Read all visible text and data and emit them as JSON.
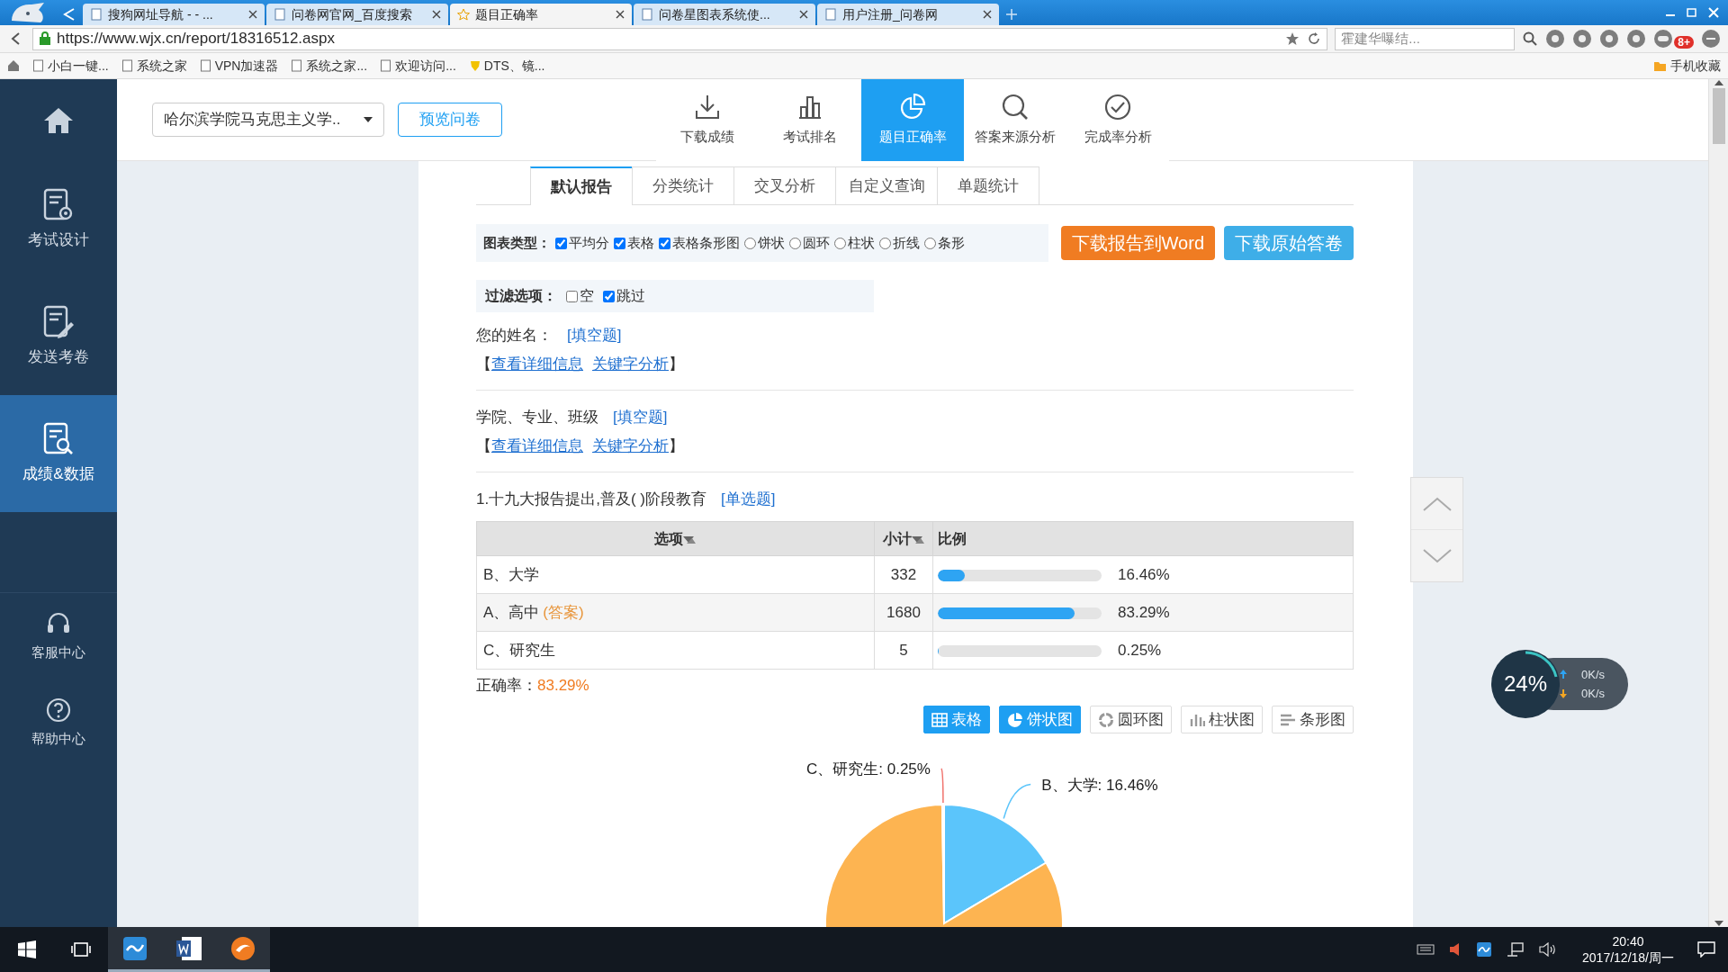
{
  "browser": {
    "tabs": [
      {
        "title": "搜狗网址导航 - - ...",
        "selected": false
      },
      {
        "title": "问卷网官网_百度搜索",
        "selected": false
      },
      {
        "title": "题目正确率",
        "selected": true
      },
      {
        "title": "问卷星图表系统使...",
        "selected": false
      },
      {
        "title": "用户注册_问卷网",
        "selected": false
      }
    ],
    "url": "https://www.wjx.cn/report/18316512.aspx",
    "search": {
      "value": "霍建华曝结..."
    },
    "badge": "8+",
    "bookmarks": [
      "小白一键...",
      "系统之家",
      "VPN加速器",
      "系统之家...",
      "欢迎访问...",
      "DTS、镜..."
    ],
    "mobile_favorites": "手机收藏"
  },
  "sidebar": {
    "items": [
      {
        "label": "考试设计",
        "selected": false
      },
      {
        "label": "发送考卷",
        "selected": false
      },
      {
        "label": "成绩&数据",
        "selected": true
      }
    ],
    "help": [
      "客服中心",
      "帮助中心"
    ]
  },
  "header": {
    "survey_select": "哈尔滨学院马克思主义学..",
    "preview": "预览问卷",
    "nav": [
      {
        "label": "下载成绩",
        "selected": false
      },
      {
        "label": "考试排名",
        "selected": false
      },
      {
        "label": "题目正确率",
        "selected": true
      },
      {
        "label": "答案来源分析",
        "selected": false
      },
      {
        "label": "完成率分析",
        "selected": false
      }
    ]
  },
  "report": {
    "tabs": [
      {
        "label": "默认报告",
        "selected": true
      },
      {
        "label": "分类统计",
        "selected": false
      },
      {
        "label": "交叉分析",
        "selected": false
      },
      {
        "label": "自定义查询",
        "selected": false
      },
      {
        "label": "单题统计",
        "selected": false
      }
    ],
    "chart_type": {
      "label": "图表类型：",
      "options": [
        {
          "label": "平均分",
          "kind": "checkbox",
          "checked": true
        },
        {
          "label": "表格",
          "kind": "checkbox",
          "checked": true
        },
        {
          "label": "表格条形图",
          "kind": "checkbox",
          "checked": true
        },
        {
          "label": "饼状",
          "kind": "radio",
          "checked": false
        },
        {
          "label": "圆环",
          "kind": "radio",
          "checked": false
        },
        {
          "label": "柱状",
          "kind": "radio",
          "checked": false
        },
        {
          "label": "折线",
          "kind": "radio",
          "checked": false
        },
        {
          "label": "条形",
          "kind": "radio",
          "checked": false
        }
      ]
    },
    "downloads": [
      {
        "label": "下载报告到Word",
        "color": "#f07c22"
      },
      {
        "label": "下载原始答卷",
        "color": "#3eaee8"
      }
    ],
    "filter": {
      "label": "过滤选项：",
      "options": [
        {
          "label": "空",
          "checked": false
        },
        {
          "label": "跳过",
          "checked": true
        }
      ]
    },
    "text_questions": [
      {
        "title": "您的姓名：",
        "type": "[填空题]",
        "open": "【",
        "links": [
          "查看详细信息",
          "关键字分析"
        ],
        "close": "】"
      },
      {
        "title": "学院、专业、班级",
        "type": "[填空题]",
        "open": "【",
        "links": [
          "查看详细信息",
          "关键字分析"
        ],
        "close": "】"
      }
    ],
    "question": {
      "title": "1.十九大报告提出,普及( )阶段教育",
      "type": "[单选题]",
      "columns": [
        "选项",
        "小计",
        "比例"
      ],
      "rows": [
        {
          "option": "B、大学",
          "count": "332",
          "level": 0.1646,
          "percent": "16.46%"
        },
        {
          "option": "A、高中",
          "note": "(答案)",
          "count": "1680",
          "level": 0.8329,
          "percent": "83.29%"
        },
        {
          "option": "C、研究生",
          "count": "5",
          "level": 0.0025,
          "percent": "0.25%"
        }
      ],
      "accuracy_label": "正确率：",
      "accuracy": "83.29%",
      "views": [
        {
          "label": "表格",
          "selected": true
        },
        {
          "label": "饼状图",
          "selected": true
        },
        {
          "label": "圆环图",
          "selected": false
        },
        {
          "label": "柱状图",
          "selected": false
        },
        {
          "label": "条形图",
          "selected": false
        }
      ],
      "chart_data": {
        "type": "pie",
        "values": [
          16.46,
          83.29,
          0.25
        ],
        "colors": [
          "#5bc5fb",
          "#fdb451",
          "#f0716b"
        ],
        "value_labels": [
          "B、大学: 16.46%",
          null,
          "C、研究生: 0.25%"
        ]
      }
    }
  },
  "widget": {
    "value": "24%",
    "up": "0K/s",
    "down": "0K/s"
  },
  "taskbar": {
    "time": "20:40",
    "date": "2017/12/18/周一"
  }
}
